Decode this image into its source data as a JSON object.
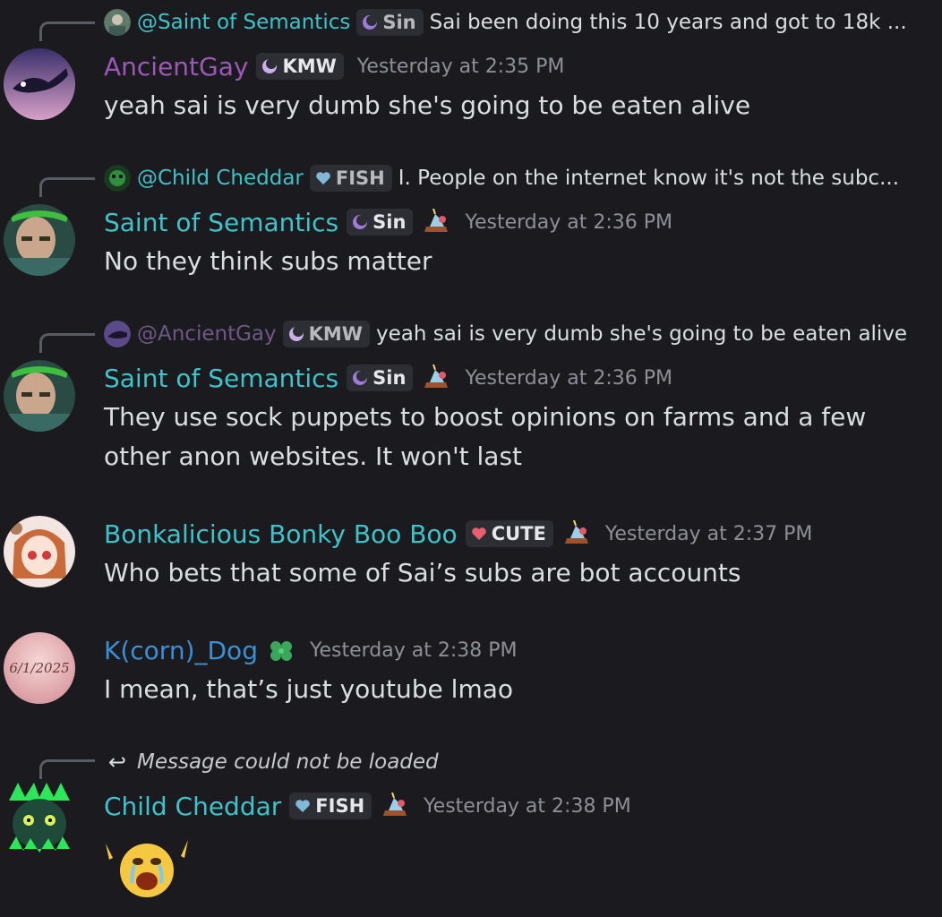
{
  "messages": [
    {
      "reply": {
        "name": "@Saint of Semantics",
        "tag": "Sin",
        "text": "Sai been doing this 10 years and got to 18k ..."
      },
      "author": {
        "name": "AncientGay",
        "color": "#9b59b6",
        "tag": "KMW"
      },
      "timestamp": "Yesterday at 2:35 PM",
      "text": "yeah sai is very dumb she's going to be eaten alive"
    },
    {
      "reply": {
        "name": "@Child Cheddar",
        "tag": "FISH",
        "text": "I. People on the internet know it's not the subc..."
      },
      "author": {
        "name": "Saint of Semantics",
        "color": "#3fc2c9",
        "tag": "Sin"
      },
      "timestamp": "Yesterday at 2:36 PM",
      "text": "No they think subs matter"
    },
    {
      "reply": {
        "name": "@AncientGay",
        "tag": "KMW",
        "text": "yeah sai is very dumb she's going to be eaten alive"
      },
      "author": {
        "name": "Saint of Semantics",
        "color": "#3fc2c9",
        "tag": "Sin"
      },
      "timestamp": "Yesterday at 2:36 PM",
      "text": "They use sock puppets to boost opinions on farms and a few other anon websites. It won't last"
    },
    {
      "author": {
        "name": "Bonkalicious Bonky Boo Boo",
        "color": "#3fc2c9",
        "tag": "CUTE"
      },
      "timestamp": "Yesterday at 2:37 PM",
      "text": "Who bets that some of Sai’s subs are bot accounts"
    },
    {
      "author": {
        "name": "K(corn)_Dog",
        "color": "#3b8fd6",
        "avatar_text": "6/1/2025"
      },
      "timestamp": "Yesterday at 2:38 PM",
      "text": "I mean, that’s just youtube lmao"
    },
    {
      "reply": {
        "text": "Message could not be loaded"
      },
      "author": {
        "name": "Child Cheddar",
        "color": "#3fc2c9",
        "tag": "FISH"
      },
      "timestamp": "Yesterday at 2:38 PM",
      "text": ""
    }
  ]
}
